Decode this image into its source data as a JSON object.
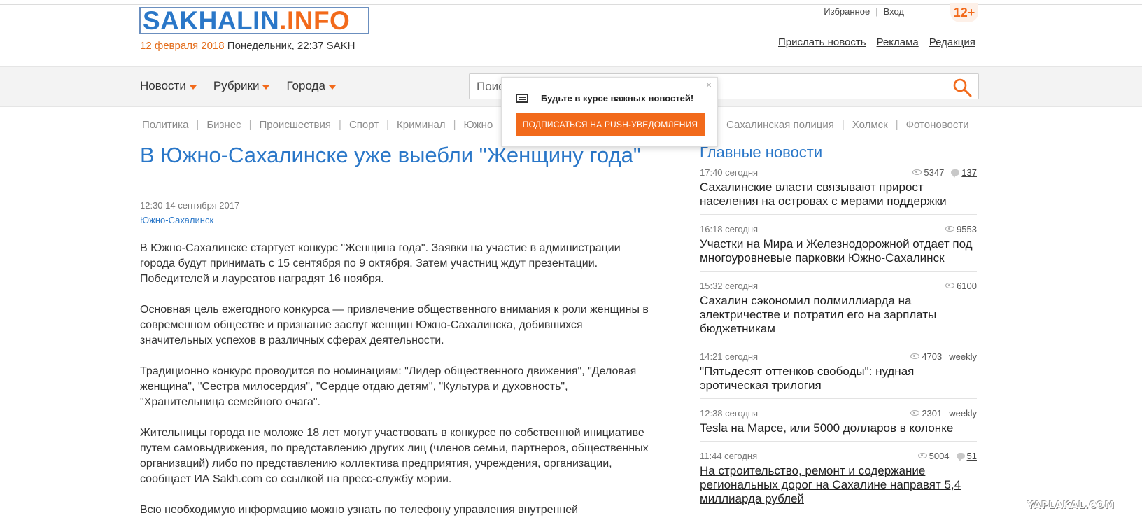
{
  "logo": {
    "part1": "SAKHALIN",
    "part2": ".INFO"
  },
  "header": {
    "date": "12 февраля 2018",
    "day_time": "Понедельник, 22:37 SAKH",
    "favorites": "Избранное",
    "separator": "|",
    "login": "Вход",
    "age_rating": "12+",
    "links": [
      "Прислать новость",
      "Реклама",
      "Редакция"
    ]
  },
  "nav": {
    "menu": [
      "Новости",
      "Рубрики",
      "Города"
    ],
    "search_placeholder": "Поиск"
  },
  "rubrics": {
    "left": [
      "Политика",
      "Бизнес",
      "Происшествия",
      "Спорт",
      "Криминал",
      "Южно"
    ],
    "right": [
      "Сахалинская полиция",
      "Холмск",
      "Фотоновости"
    ]
  },
  "popup": {
    "message": "Будьте в курсе важных новостей!",
    "button": "ПОДПИСАТЬСЯ НА PUSH-УВЕДОМЛЕНИЯ",
    "close": "×"
  },
  "article": {
    "title": "В Южно-Сахалинске уже выебли \"Женщину года\"",
    "datetime": "12:30 14 сентября 2017",
    "city": "Южно-Сахалинск",
    "paragraphs": [
      "В Южно-Сахалинске стартует конкурс \"Женщина года\". Заявки на участие в администрации города будут принимать с 15 сентября по 9 октября. Затем участниц ждут презентации. Победителей и лауреатов наградят 16 ноября.",
      "Основная цель ежегодного конкурса — привлечение общественного внимания к роли женщины в современном обществе и признание заслуг женщин Южно-Сахалинска, добившихся значительных успехов в различных сферах деятельности.",
      "Традиционно конкурс проводится по номинациям: \"Лидер общественного движения\", \"Деловая женщина\", \"Сестра милосердия\", \"Сердце отдаю детям\", \"Культура и духовность\", \"Хранительница семейного очага\".",
      "Жительницы города не моложе 18 лет могут участвовать в конкурсе по собственной инициативе путем самовыдвижения, по представлению других лиц (членов семьи, партнеров, общественных организаций) либо по представлению коллектива предприятия, учреждения, организации, сообщает ИА Sakh.com со ссылкой на пресс-службу мэрии.",
      "Всю необходимую информацию можно узнать по телефону управления внутренней"
    ]
  },
  "sidebar": {
    "title": "Главные новости",
    "items": [
      {
        "time": "17:40 сегодня",
        "views": "5347",
        "comments": "137",
        "weekly": "",
        "headline": "Сахалинские власти связывают прирост населения на островах с мерами поддержки"
      },
      {
        "time": "16:18 сегодня",
        "views": "9553",
        "comments": "",
        "weekly": "",
        "headline": "Участки на Мира и Железнодорожной отдает под многоуровневые парковки Южно-Сахалинск"
      },
      {
        "time": "15:32 сегодня",
        "views": "6100",
        "comments": "",
        "weekly": "",
        "headline": "Сахалин сэкономил полмиллиарда на электричестве и потратил его на зарплаты бюджетникам"
      },
      {
        "time": "14:21 сегодня",
        "views": "4703",
        "comments": "",
        "weekly": "weekly",
        "headline": "\"Пятьдесят оттенков свободы\": нудная эротическая трилогия"
      },
      {
        "time": "12:38 сегодня",
        "views": "2301",
        "comments": "",
        "weekly": "weekly",
        "headline": "Tesla на Марсе, или 5000 долларов в колонке"
      },
      {
        "time": "11:44 сегодня",
        "views": "5004",
        "comments": "51",
        "weekly": "",
        "headline": "На строительство, ремонт и содержание региональных дорог на Сахалине направят 5,4 миллиарда рублей"
      }
    ]
  },
  "watermark": "YAPLAKAL.COM"
}
